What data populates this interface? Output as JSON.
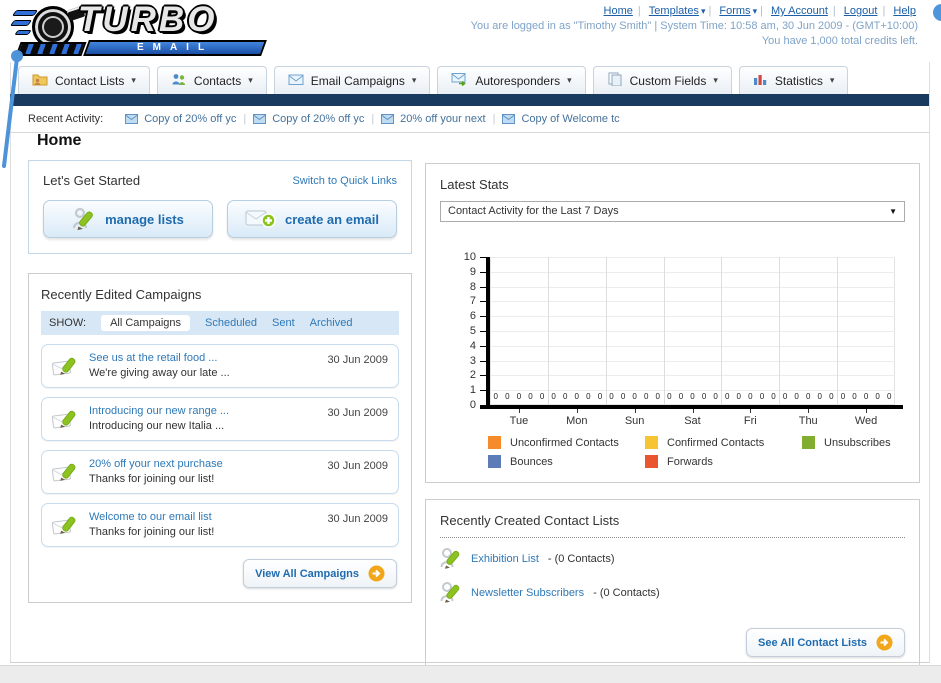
{
  "header": {
    "logo": {
      "title": "TURBO",
      "subtitle": "EMAIL"
    },
    "nav": [
      {
        "label": "Home",
        "has_menu": false
      },
      {
        "label": "Templates",
        "has_menu": true
      },
      {
        "label": "Forms",
        "has_menu": true
      },
      {
        "label": "My Account",
        "has_menu": false
      },
      {
        "label": "Logout",
        "has_menu": false
      },
      {
        "label": "Help",
        "has_menu": false
      }
    ],
    "login_line": "You are logged in as \"Timothy Smith\" | System Time: 10:58 am, 30 Jun 2009 - (GMT+10:00)",
    "credits_line": "You have 1,000 total credits left."
  },
  "tabs": [
    {
      "label": "Contact Lists",
      "icon": "folder-user-icon"
    },
    {
      "label": "Contacts",
      "icon": "people-icon"
    },
    {
      "label": "Email Campaigns",
      "icon": "envelope-icon"
    },
    {
      "label": "Autoresponders",
      "icon": "envelope-arrow-icon"
    },
    {
      "label": "Custom Fields",
      "icon": "pages-icon"
    },
    {
      "label": "Statistics",
      "icon": "bar-chart-icon"
    }
  ],
  "recent_activity": {
    "label": "Recent Activity:",
    "items": [
      "Copy of 20% off yc",
      "Copy of 20% off yc",
      "20% off your next ",
      "Copy of Welcome tc"
    ]
  },
  "page_title": "Home",
  "get_started": {
    "title": "Let's Get Started",
    "switch_link": "Switch to Quick Links",
    "buttons": [
      {
        "label": "manage lists",
        "icon": "person-pencil-icon"
      },
      {
        "label": "create an email",
        "icon": "envelope-plus-icon"
      }
    ]
  },
  "campaigns": {
    "title": "Recently Edited Campaigns",
    "show_label": "SHOW:",
    "filters": [
      "All Campaigns",
      "Scheduled",
      "Sent",
      "Archived"
    ],
    "active_filter": "All Campaigns",
    "items": [
      {
        "title": "See us at the retail food ...",
        "subtitle": "We're giving away our late ...",
        "date": "30 Jun 2009"
      },
      {
        "title": "Introducing our new range ...",
        "subtitle": "Introducing our new Italia ...",
        "date": "30 Jun 2009"
      },
      {
        "title": "20% off your next purchase",
        "subtitle": "Thanks for joining our list!",
        "date": "30 Jun 2009"
      },
      {
        "title": "Welcome to our email list",
        "subtitle": "Thanks for joining our list!",
        "date": "30 Jun 2009"
      }
    ],
    "view_all_label": "View All Campaigns"
  },
  "latest_stats": {
    "title": "Latest Stats",
    "dropdown_value": "Contact Activity for the Last 7 Days"
  },
  "chart_data": {
    "type": "bar",
    "title": "Contact Activity for the Last 7 Days",
    "categories": [
      "Tue",
      "Mon",
      "Sun",
      "Sat",
      "Fri",
      "Thu",
      "Wed"
    ],
    "series": [
      {
        "name": "Unconfirmed Contacts",
        "color": "#F68B2C",
        "values": [
          0,
          0,
          0,
          0,
          0,
          0,
          0
        ]
      },
      {
        "name": "Confirmed Contacts",
        "color": "#F7C533",
        "values": [
          0,
          0,
          0,
          0,
          0,
          0,
          0
        ]
      },
      {
        "name": "Unsubscribes",
        "color": "#82AE2F",
        "values": [
          0,
          0,
          0,
          0,
          0,
          0,
          0
        ]
      },
      {
        "name": "Bounces",
        "color": "#5C7CB8",
        "values": [
          0,
          0,
          0,
          0,
          0,
          0,
          0
        ]
      },
      {
        "name": "Forwards",
        "color": "#E8552F",
        "values": [
          0,
          0,
          0,
          0,
          0,
          0,
          0
        ]
      }
    ],
    "xlabel": "",
    "ylabel": "",
    "ylim": [
      0,
      10
    ],
    "yticks": [
      0,
      1,
      2,
      3,
      4,
      5,
      6,
      7,
      8,
      9,
      10
    ],
    "grid": true,
    "value_labels": true,
    "legend_position": "bottom"
  },
  "contact_lists": {
    "title": "Recently Created Contact Lists",
    "items": [
      {
        "name": "Exhibition List",
        "detail": "- (0 Contacts)"
      },
      {
        "name": "Newsletter Subscribers",
        "detail": "- (0 Contacts)"
      }
    ],
    "see_all_label": "See All Contact Lists"
  }
}
